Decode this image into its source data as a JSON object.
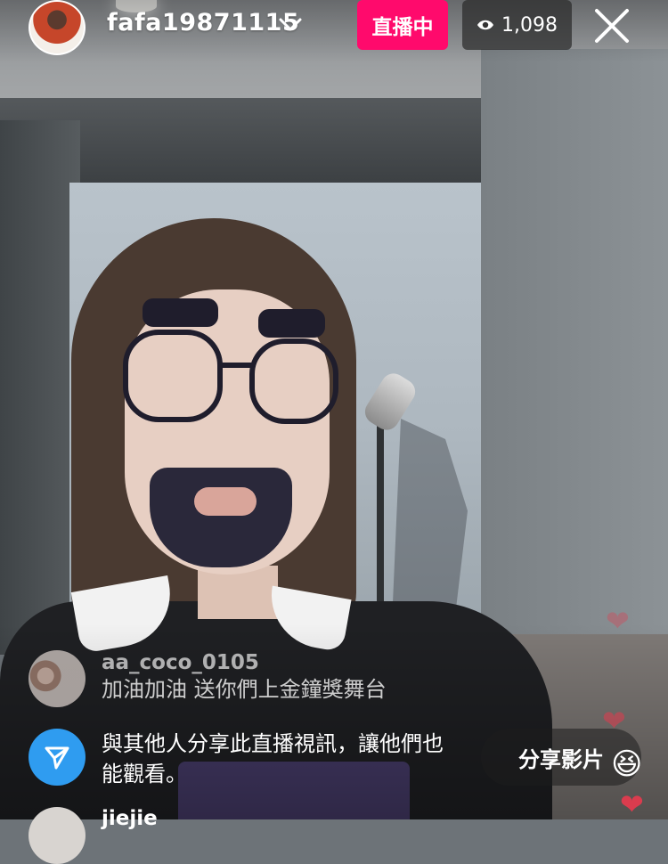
{
  "header": {
    "username": "fafa19871115",
    "live_label": "直播中",
    "viewer_count": "1,098"
  },
  "comments": [
    {
      "user": "aa_coco_0105",
      "text": "加油加油 送你們上金鐘獎舞台"
    }
  ],
  "share_prompt": {
    "text": "與其他人分享此直播視訊，讓他們也能觀看。"
  },
  "partial_comment_user": "jiejie",
  "share_button_label": "分享影片",
  "colors": {
    "live_badge": "#ff0a6c",
    "share_icon_bg": "#2f9cf0",
    "heart": "#e23b4e"
  },
  "icons": [
    "chevron-down-icon",
    "eye-icon",
    "close-icon",
    "send-icon",
    "heart-icon",
    "laughing-emoji-icon"
  ]
}
